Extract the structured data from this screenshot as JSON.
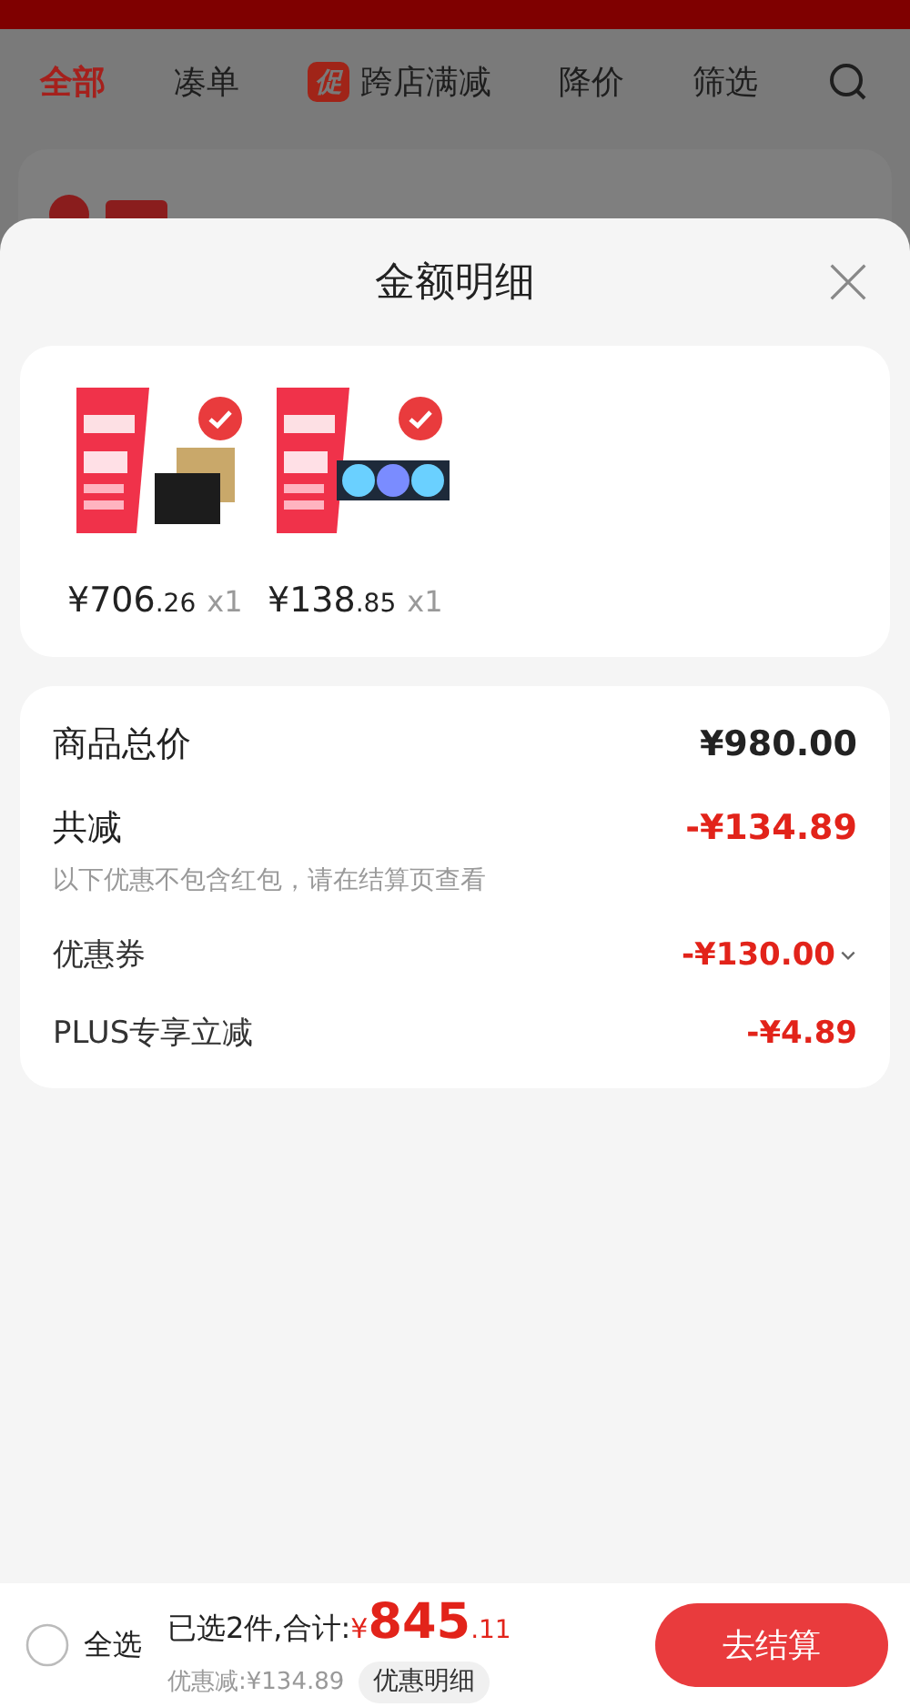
{
  "nav_tabs": [
    {
      "label": "全部",
      "selected": true
    },
    {
      "label": "凑单",
      "selected": false
    },
    {
      "label": "跨店满减",
      "selected": false,
      "badge": "促"
    },
    {
      "label": "降价",
      "selected": false
    },
    {
      "label": "筛选",
      "selected": false
    }
  ],
  "sheet": {
    "title": "金额明细",
    "products": [
      {
        "price_integer": "¥706",
        "price_decimal": ".26",
        "quantity": "x1",
        "selected": true
      },
      {
        "price_integer": "¥138",
        "price_decimal": ".85",
        "quantity": "x1",
        "selected": true
      }
    ],
    "summary": [
      {
        "kind": "total",
        "label": "商品总价",
        "value": "¥980.00"
      },
      {
        "kind": "reduction",
        "label": "共减",
        "value": "-¥134.89",
        "note": "以下优惠不包含红包，请在结算页查看"
      },
      {
        "kind": "dropdown",
        "label": "优惠券",
        "value": "-¥130.00"
      },
      {
        "kind": "item",
        "label": "PLUS专享立减",
        "value": "-¥4.89"
      }
    ]
  },
  "bottom_bar": {
    "select_all": {
      "label": "全选",
      "checked": false
    },
    "selected_count": "已选2件,合计:",
    "total_currency": "¥",
    "total_integer": "845",
    "total_decimal": ".11",
    "discount": "优惠减:¥134.89",
    "details_button": "优惠明细",
    "checkout_button": "去结算"
  }
}
